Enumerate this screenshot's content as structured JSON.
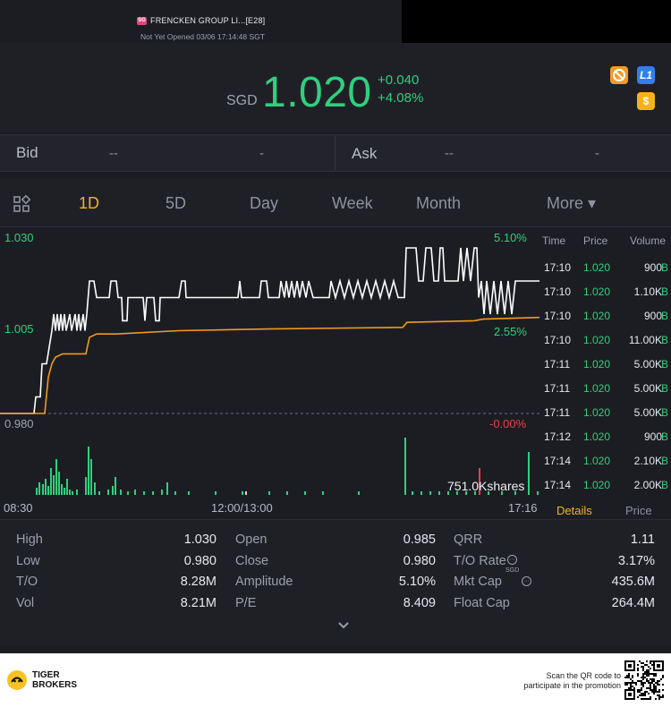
{
  "header": {
    "market_badge": "SG",
    "stock_name": "FRENCKEN GROUP LI...[E28]",
    "status": "Not Yet Opened 03/06 17:14:48 SGT"
  },
  "quote": {
    "currency": "SGD",
    "price": "1.020",
    "change": "+0.040",
    "change_pct": "+4.08%",
    "icons": [
      "no-short-icon",
      "level1-icon",
      "dollar-icon"
    ],
    "l1_label": "L1",
    "dollar_label": "$",
    "up_color": "#2fd07d"
  },
  "bidask": {
    "bid_label": "Bid",
    "bid_price": "--",
    "bid_size": "-",
    "ask_label": "Ask",
    "ask_price": "--",
    "ask_size": "-"
  },
  "tabs": [
    {
      "label": "1D",
      "active": true
    },
    {
      "label": "5D"
    },
    {
      "label": "Day"
    },
    {
      "label": "Week"
    },
    {
      "label": "Month"
    },
    {
      "label": "More ▾"
    }
  ],
  "chart_data": {
    "type": "line",
    "y_labels": {
      "top": "1.030",
      "mid": "1.005",
      "bottom": "0.980"
    },
    "pct_labels": {
      "top": "5.10%",
      "mid": "2.55%",
      "bottom": "-0.00%"
    },
    "ylim": [
      0.98,
      1.03
    ],
    "x_labels": [
      "08:30",
      "12:00/13:00",
      "17:16"
    ],
    "volume_label": "751.0Kshares",
    "series": [
      {
        "color": "#ffffff",
        "points": [
          [
            0,
            0.98
          ],
          [
            38,
            0.98
          ],
          [
            40,
            0.985
          ],
          [
            45,
            0.985
          ],
          [
            47,
            0.995
          ],
          [
            52,
            0.995
          ],
          [
            55,
            1.0
          ],
          [
            58,
            1.005
          ],
          [
            60,
            1.01
          ],
          [
            62,
            1.005
          ],
          [
            64,
            1.01
          ],
          [
            66,
            1.005
          ],
          [
            68,
            1.01
          ],
          [
            70,
            1.005
          ],
          [
            72,
            1.01
          ],
          [
            74,
            1.005
          ],
          [
            78,
            1.01
          ],
          [
            80,
            1.005
          ],
          [
            84,
            1.01
          ],
          [
            86,
            1.005
          ],
          [
            88,
            1.01
          ],
          [
            90,
            1.005
          ],
          [
            93,
            1.01
          ],
          [
            95,
            1.005
          ],
          [
            97,
            1.01
          ],
          [
            100,
            1.02
          ],
          [
            105,
            1.02
          ],
          [
            108,
            1.015
          ],
          [
            122,
            1.015
          ],
          [
            124,
            1.02
          ],
          [
            130,
            1.02
          ],
          [
            132,
            1.015
          ],
          [
            136,
            1.015
          ],
          [
            137,
            1.008
          ],
          [
            142,
            1.008
          ],
          [
            143,
            1.015
          ],
          [
            160,
            1.015
          ],
          [
            162,
            1.008
          ],
          [
            164,
            1.015
          ],
          [
            172,
            1.015
          ],
          [
            174,
            1.008
          ],
          [
            178,
            1.008
          ],
          [
            179,
            1.015
          ],
          [
            200,
            1.015
          ],
          [
            203,
            1.02
          ],
          [
            207,
            1.02
          ],
          [
            208,
            1.015
          ],
          [
            266,
            1.015
          ],
          [
            268,
            1.02
          ],
          [
            270,
            1.015
          ],
          [
            290,
            1.015
          ],
          [
            292,
            1.02
          ],
          [
            298,
            1.02
          ],
          [
            300,
            1.015
          ],
          [
            312,
            1.015
          ],
          [
            314,
            1.02
          ],
          [
            318,
            1.015
          ],
          [
            320,
            1.02
          ],
          [
            323,
            1.015
          ],
          [
            326,
            1.02
          ],
          [
            329,
            1.015
          ],
          [
            332,
            1.02
          ],
          [
            335,
            1.015
          ],
          [
            338,
            1.02
          ],
          [
            342,
            1.015
          ],
          [
            345,
            1.02
          ],
          [
            350,
            1.015
          ],
          [
            368,
            1.015
          ],
          [
            370,
            1.02
          ],
          [
            375,
            1.015
          ],
          [
            380,
            1.02
          ],
          [
            385,
            1.015
          ],
          [
            390,
            1.02
          ],
          [
            395,
            1.015
          ],
          [
            400,
            1.02
          ],
          [
            405,
            1.015
          ],
          [
            410,
            1.02
          ],
          [
            415,
            1.015
          ],
          [
            420,
            1.02
          ],
          [
            425,
            1.015
          ],
          [
            430,
            1.02
          ],
          [
            435,
            1.015
          ],
          [
            440,
            1.02
          ],
          [
            445,
            1.015
          ],
          [
            452,
            1.015
          ],
          [
            454,
            1.03
          ],
          [
            465,
            1.03
          ],
          [
            468,
            1.02
          ],
          [
            473,
            1.02
          ],
          [
            476,
            1.03
          ],
          [
            482,
            1.03
          ],
          [
            485,
            1.02
          ],
          [
            490,
            1.02
          ],
          [
            492,
            1.03
          ],
          [
            495,
            1.03
          ],
          [
            497,
            1.02
          ],
          [
            512,
            1.02
          ],
          [
            515,
            1.03
          ],
          [
            518,
            1.02
          ],
          [
            522,
            1.03
          ],
          [
            526,
            1.02
          ],
          [
            530,
            1.03
          ],
          [
            533,
            1.03
          ],
          [
            535,
            1.015
          ],
          [
            538,
            1.02
          ],
          [
            541,
            1.01
          ],
          [
            544,
            1.02
          ],
          [
            548,
            1.01
          ],
          [
            552,
            1.02
          ],
          [
            556,
            1.01
          ],
          [
            560,
            1.02
          ],
          [
            564,
            1.01
          ],
          [
            568,
            1.02
          ],
          [
            572,
            1.01
          ],
          [
            576,
            1.02
          ],
          [
            603,
            1.02
          ]
        ]
      },
      {
        "color": "#f29a1f",
        "points": [
          [
            0,
            0.98
          ],
          [
            50,
            0.98
          ],
          [
            54,
            0.991
          ],
          [
            58,
            0.995
          ],
          [
            62,
            0.997
          ],
          [
            70,
            0.998
          ],
          [
            96,
            0.998
          ],
          [
            100,
            1.003
          ],
          [
            108,
            1.004
          ],
          [
            130,
            1.004
          ],
          [
            200,
            1.005
          ],
          [
            300,
            1.0055
          ],
          [
            450,
            1.006
          ],
          [
            455,
            1.0075
          ],
          [
            530,
            1.008
          ],
          [
            540,
            1.0085
          ],
          [
            603,
            1.009
          ]
        ]
      }
    ],
    "volume_bars": {
      "green": [
        [
          40,
          8
        ],
        [
          43,
          14
        ],
        [
          47,
          12
        ],
        [
          50,
          18
        ],
        [
          53,
          10
        ],
        [
          56,
          30
        ],
        [
          59,
          22
        ],
        [
          62,
          40
        ],
        [
          65,
          26
        ],
        [
          68,
          12
        ],
        [
          71,
          8
        ],
        [
          74,
          18
        ],
        [
          77,
          6
        ],
        [
          80,
          4
        ],
        [
          85,
          6
        ],
        [
          95,
          20
        ],
        [
          98,
          54
        ],
        [
          101,
          40
        ],
        [
          105,
          14
        ],
        [
          110,
          4
        ],
        [
          120,
          6
        ],
        [
          125,
          10
        ],
        [
          128,
          20
        ],
        [
          134,
          6
        ],
        [
          142,
          4
        ],
        [
          150,
          6
        ],
        [
          160,
          4
        ],
        [
          170,
          4
        ],
        [
          180,
          6
        ],
        [
          186,
          14
        ],
        [
          195,
          4
        ],
        [
          210,
          4
        ],
        [
          240,
          4
        ],
        [
          270,
          4
        ],
        [
          300,
          4
        ],
        [
          320,
          4
        ],
        [
          340,
          4
        ],
        [
          360,
          4
        ],
        [
          400,
          4
        ],
        [
          452,
          64
        ],
        [
          460,
          4
        ],
        [
          470,
          4
        ],
        [
          480,
          4
        ],
        [
          490,
          4
        ],
        [
          500,
          4
        ],
        [
          510,
          4
        ],
        [
          520,
          4
        ],
        [
          530,
          4
        ],
        [
          545,
          4
        ],
        [
          560,
          4
        ],
        [
          575,
          4
        ],
        [
          590,
          48
        ],
        [
          600,
          4
        ]
      ],
      "red": [
        [
          535,
          30
        ]
      ],
      "white": [
        [
          274,
          4
        ]
      ]
    }
  },
  "trades": {
    "headers": {
      "time": "Time",
      "price": "Price",
      "volume": "Volume"
    },
    "rows": [
      {
        "time": "17:10",
        "price": "1.020",
        "volume": "900"
      },
      {
        "time": "17:10",
        "price": "1.020",
        "volume": "1.10K"
      },
      {
        "time": "17:10",
        "price": "1.020",
        "volume": "900"
      },
      {
        "time": "17:10",
        "price": "1.020",
        "volume": "11.00K"
      },
      {
        "time": "17:11",
        "price": "1.020",
        "volume": "5.00K"
      },
      {
        "time": "17:11",
        "price": "1.020",
        "volume": "5.00K"
      },
      {
        "time": "17:11",
        "price": "1.020",
        "volume": "5.00K"
      },
      {
        "time": "17:12",
        "price": "1.020",
        "volume": "900"
      },
      {
        "time": "17:14",
        "price": "1.020",
        "volume": "2.10K"
      },
      {
        "time": "17:14",
        "price": "1.020",
        "volume": "2.00K"
      }
    ],
    "side_marker": "B",
    "details_tab": "Details",
    "price_tab": "Price"
  },
  "stats": {
    "col1": [
      {
        "label": "High",
        "value": "1.030"
      },
      {
        "label": "Low",
        "value": "0.980"
      },
      {
        "label": "T/O",
        "value": "8.28M"
      },
      {
        "label": "Vol",
        "value": "8.21M"
      }
    ],
    "col2": [
      {
        "label": "Open",
        "value": "0.985"
      },
      {
        "label": "Close",
        "value": "0.980"
      },
      {
        "label": "Amplitude",
        "value": "5.10%"
      },
      {
        "label": "P/E",
        "value": "8.409"
      }
    ],
    "col3": [
      {
        "label": "QRR",
        "value": "1.11"
      },
      {
        "label": "T/O Rate",
        "value": "3.17%"
      },
      {
        "label": "Mkt Cap",
        "value": "435.6M",
        "superscript": "SGD"
      },
      {
        "label": "Float Cap",
        "value": "264.4M"
      }
    ]
  },
  "footer": {
    "brand_line1": "TIGER",
    "brand_line2": "BROKERS",
    "promo_line1": "Scan the QR code to",
    "promo_line2": "participate in the promotion"
  }
}
